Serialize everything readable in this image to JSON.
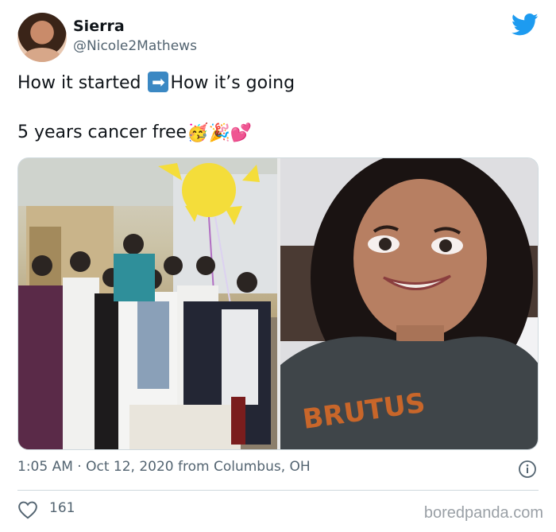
{
  "tweet": {
    "display_name": "Sierra",
    "handle": "@Nicole2Mathews",
    "line1_before": "How it started",
    "line1_arrow": "➡",
    "line1_after": "How it’s going",
    "line2_text": "5 years cancer free",
    "line2_emoji": [
      "🥳",
      "🎉",
      "💕"
    ],
    "timestamp": "1:05 AM · Oct 12, 2020 from Columbus, OH",
    "like_count": "161"
  },
  "media": {
    "left_image": "photo-hospital-group",
    "right_image": "photo-selfie"
  },
  "watermark": "boredpanda.com",
  "colors": {
    "twitter_blue": "#1d9bf0",
    "text_primary": "#0f1419",
    "text_secondary": "#536471",
    "divider": "#cfd9de"
  },
  "icons": {
    "brand": "twitter-bird-icon",
    "info": "info-icon",
    "like": "heart-icon",
    "arrow": "right-arrow-icon"
  }
}
